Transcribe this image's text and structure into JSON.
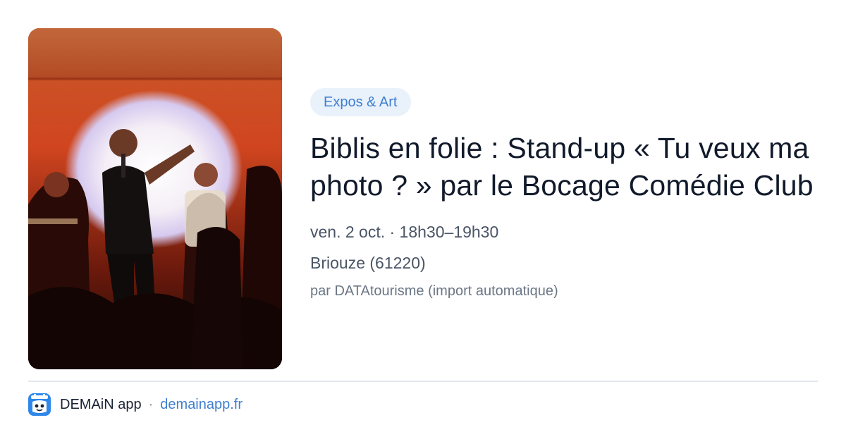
{
  "event": {
    "category": "Expos & Art",
    "title": "Biblis en folie : Stand-up « Tu veux ma photo ? » par le Bocage Comédie Club",
    "datetime": "ven. 2 oct. · 18h30–19h30",
    "location": "Briouze (61220)",
    "source": "par DATAtourisme (import automatique)",
    "image_description": "stand-up-comedian-on-stage-photo"
  },
  "footer": {
    "app_name": "DEMAiN app",
    "separator": "·",
    "domain": "demainapp.fr"
  },
  "colors": {
    "chip_background": "#e9f1fb",
    "chip_text": "#3f7fcf",
    "link": "#3f7fcf",
    "logo": "#2f87ea",
    "title": "#111a2b"
  }
}
